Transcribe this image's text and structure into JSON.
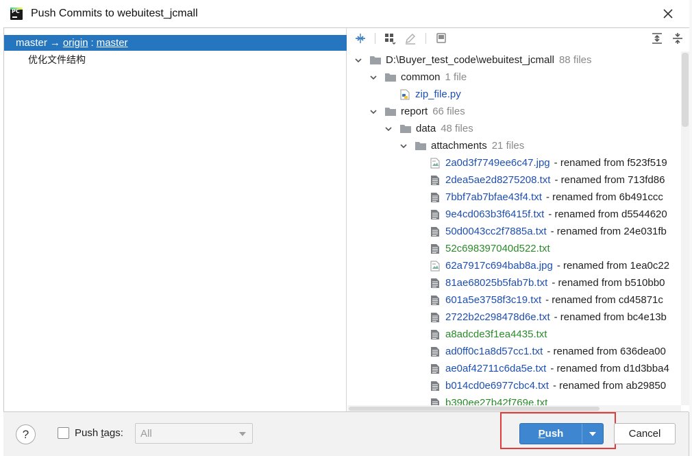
{
  "window": {
    "title": "Push Commits to webuitest_jcmall"
  },
  "commits_panel": {
    "branch": {
      "local": "master",
      "arrow": "→",
      "remote": "origin",
      "colon": ":",
      "remote_branch": "master"
    },
    "commits": [
      "优化文件结构"
    ]
  },
  "changes_panel": {
    "toolbar_icons": [
      "expand-changes-icon",
      "group-by-icon",
      "edit-source-icon",
      "show-diff-icon",
      "expand-all-icon",
      "collapse-all-icon"
    ],
    "root": {
      "label": "D:\\Buyer_test_code\\webuitest_jcmall",
      "count": "88 files"
    },
    "folders": [
      {
        "label": "common",
        "count": "1 file"
      },
      {
        "label": "report",
        "count": "66 files"
      },
      {
        "label": "data",
        "count": "48 files"
      },
      {
        "label": "attachments",
        "count": "21 files"
      }
    ],
    "common_file": "zip_file.py",
    "files": [
      {
        "name": "2a0d3f7749ee6c47.jpg",
        "status": "modified",
        "icon": "image-file-icon",
        "renamed": "- renamed from f523f519"
      },
      {
        "name": "2dea5ae2d8275208.txt",
        "status": "modified",
        "icon": "text-file-icon",
        "renamed": "- renamed from 713fd86"
      },
      {
        "name": "7bbf7ab7bfae43f4.txt",
        "status": "modified",
        "icon": "text-file-icon",
        "renamed": "- renamed from 6b491ccc"
      },
      {
        "name": "9e4cd063b3f6415f.txt",
        "status": "modified",
        "icon": "text-file-icon",
        "renamed": "- renamed from d5544620"
      },
      {
        "name": "50d0043cc2f7885a.txt",
        "status": "modified",
        "icon": "text-file-icon",
        "renamed": "- renamed from 24e031fb"
      },
      {
        "name": "52c698397040d522.txt",
        "status": "new",
        "icon": "text-file-icon",
        "renamed": ""
      },
      {
        "name": "62a7917c694bab8a.jpg",
        "status": "modified",
        "icon": "image-file-icon",
        "renamed": "- renamed from 1ea0c22"
      },
      {
        "name": "81ae68025b5fab7b.txt",
        "status": "modified",
        "icon": "text-file-icon",
        "renamed": "- renamed from b510bb0"
      },
      {
        "name": "601a5e3758f3c19.txt",
        "status": "modified",
        "icon": "text-file-icon",
        "renamed": "- renamed from cd45871c"
      },
      {
        "name": "2722b2c298478d6e.txt",
        "status": "modified",
        "icon": "text-file-icon",
        "renamed": "- renamed from bc4e13b"
      },
      {
        "name": "a8adcde3f1ea4435.txt",
        "status": "new",
        "icon": "text-file-icon",
        "renamed": ""
      },
      {
        "name": "ad0ff0c1a8d57cc1.txt",
        "status": "modified",
        "icon": "text-file-icon",
        "renamed": "- renamed from 636dea00"
      },
      {
        "name": "ae0af42711c6da5e.txt",
        "status": "modified",
        "icon": "text-file-icon",
        "renamed": "- renamed from d1d3bba4"
      },
      {
        "name": "b014cd0e6977cbc4.txt",
        "status": "modified",
        "icon": "text-file-icon",
        "renamed": "- renamed from ab29850"
      },
      {
        "name": "b390ee27b42f769e.txt",
        "status": "new",
        "icon": "text-file-icon",
        "renamed": ""
      }
    ]
  },
  "footer": {
    "help": "?",
    "push_tags_prefix": "Push ",
    "push_tags_underlined": "t",
    "push_tags_suffix": "ags:",
    "push_tags_checked": false,
    "tags_select_value": "All",
    "push_underlined": "P",
    "push_rest": "ush",
    "cancel": "Cancel"
  },
  "colors": {
    "selection": "#2675bf",
    "modified_file": "#1e4fb0",
    "new_file": "#2b8a2b",
    "primary_button": "#3e86cf",
    "highlight_box": "#e23b3b"
  }
}
